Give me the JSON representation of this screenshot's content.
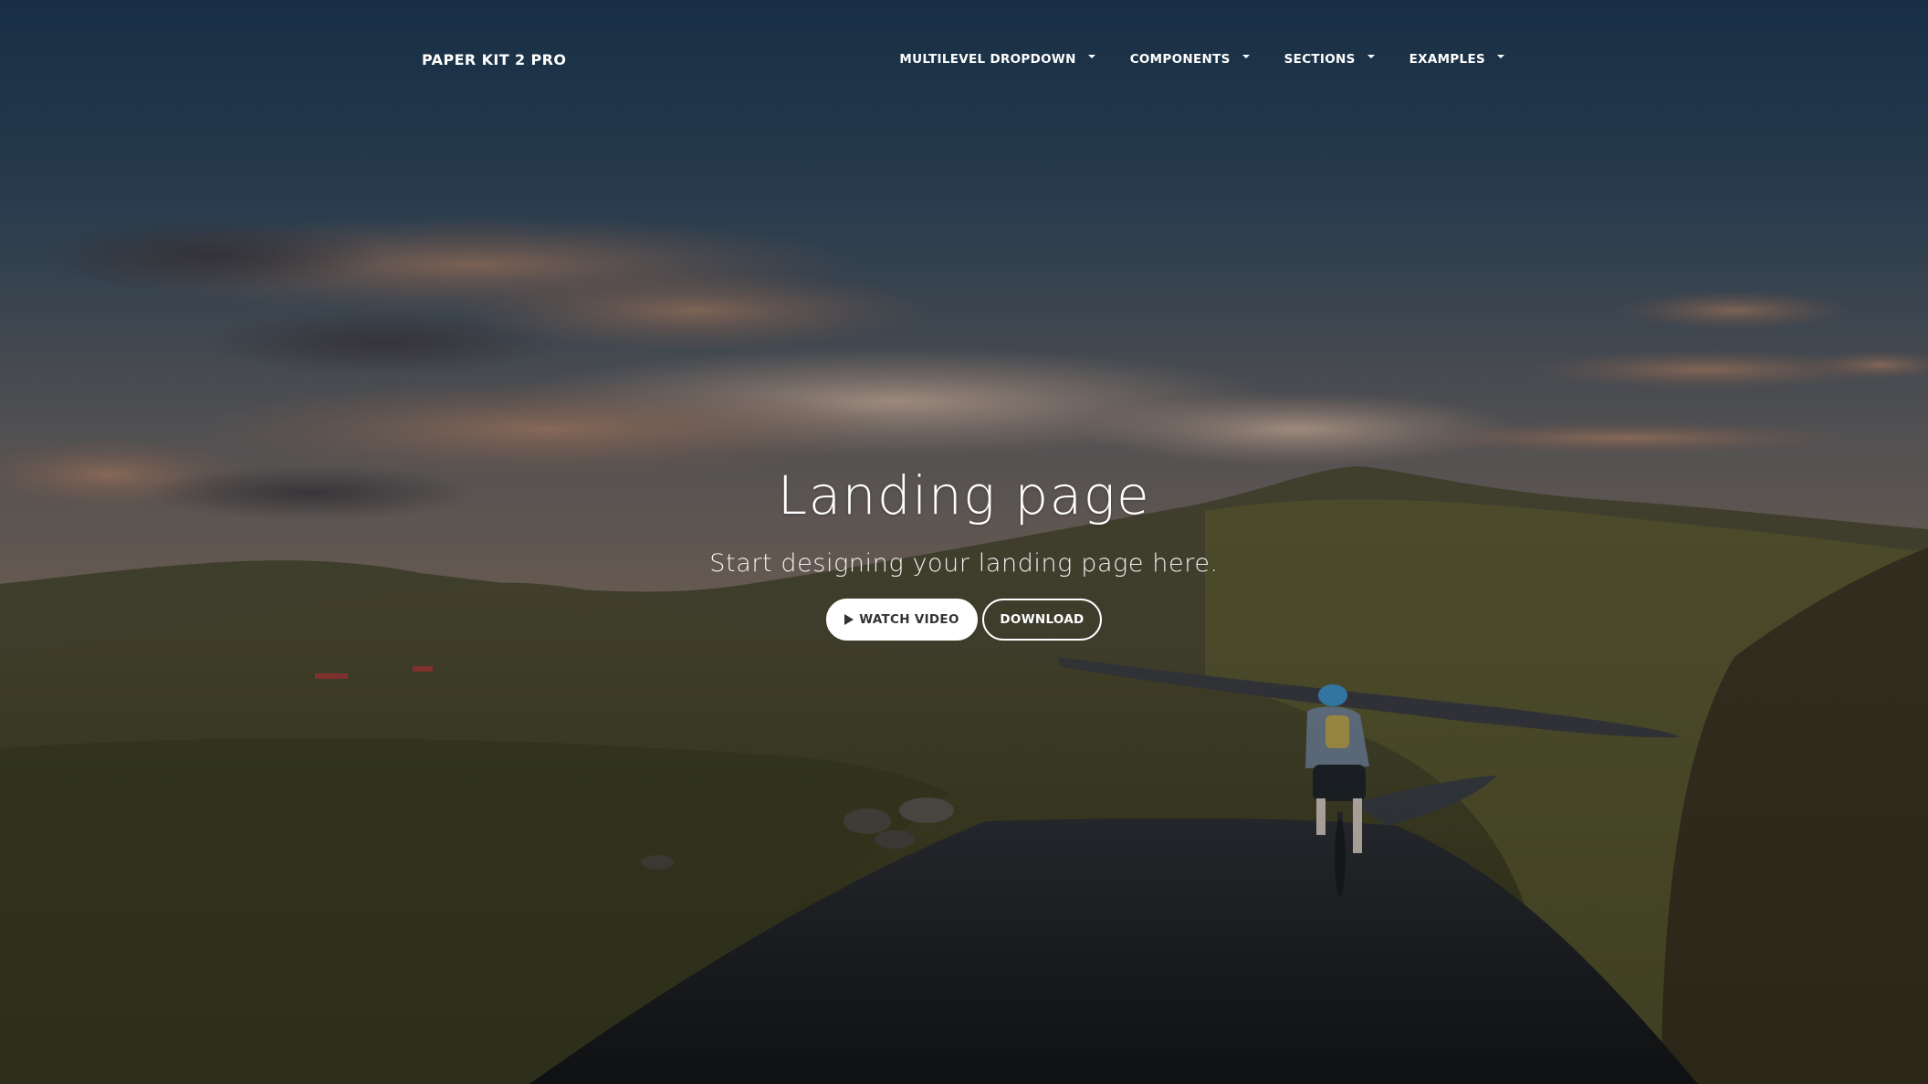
{
  "navbar": {
    "brand": "PAPER KIT 2 PRO",
    "items": [
      {
        "label": "MULTILEVEL DROPDOWN",
        "icon": "caret-down-icon"
      },
      {
        "label": "COMPONENTS",
        "icon": "caret-down-icon"
      },
      {
        "label": "SECTIONS",
        "icon": "caret-down-icon"
      },
      {
        "label": "EXAMPLES",
        "icon": "caret-down-icon"
      }
    ]
  },
  "hero": {
    "title": "Landing page",
    "subtitle": "Start designing your landing page here.",
    "watch_video_label": "WATCH VIDEO",
    "watch_video_icon": "play-icon",
    "download_label": "DOWNLOAD"
  },
  "colors": {
    "text": "#ffffff",
    "button_fill": "#ffffff",
    "button_text": "#333333"
  }
}
